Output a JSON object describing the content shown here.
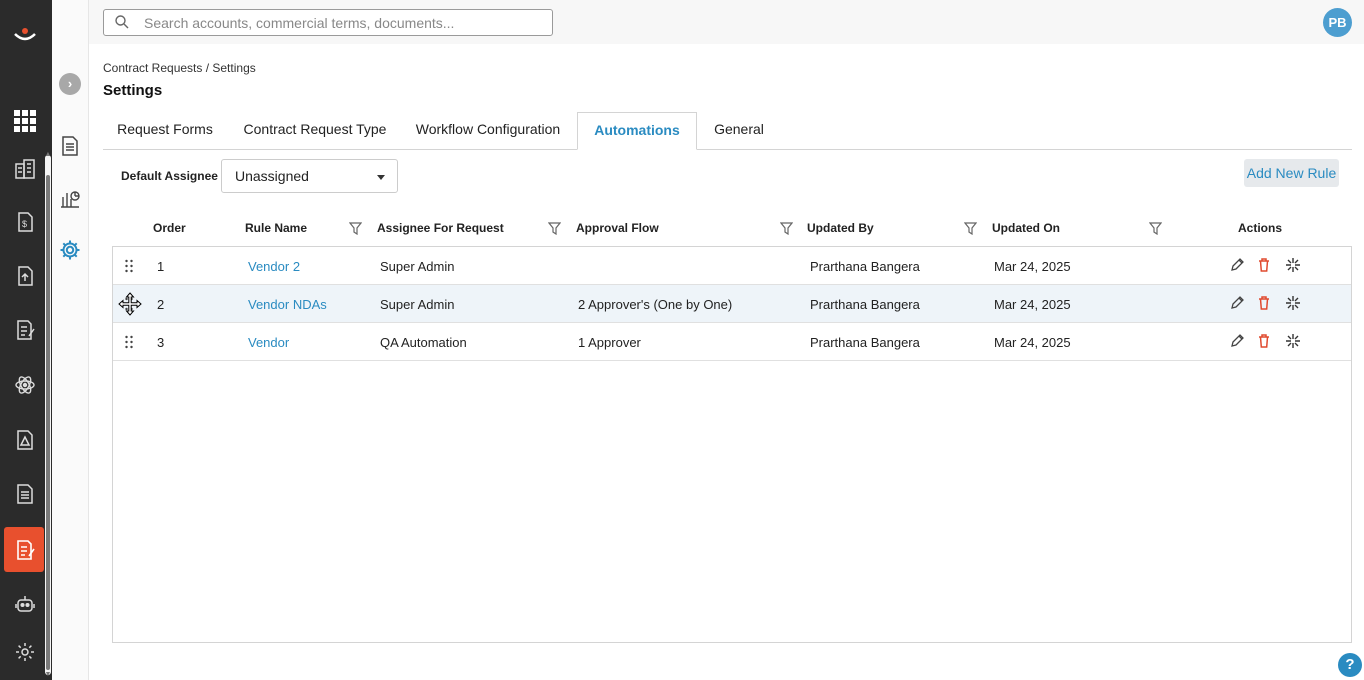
{
  "search": {
    "placeholder": "Search accounts, commercial terms, documents..."
  },
  "user": {
    "initials": "PB"
  },
  "breadcrumb": "Contract Requests / Settings",
  "page_title": "Settings",
  "tabs": [
    {
      "label": "Request Forms",
      "active": false
    },
    {
      "label": "Contract Request Type",
      "active": false
    },
    {
      "label": "Workflow Configuration",
      "active": false
    },
    {
      "label": "Automations",
      "active": true
    },
    {
      "label": "General",
      "active": false
    }
  ],
  "default_assignee": {
    "label": "Default Assignee",
    "value": "Unassigned"
  },
  "add_rule_label": "Add New Rule",
  "table": {
    "columns": [
      "Order",
      "Rule Name",
      "Assignee For Request",
      "Approval Flow",
      "Updated By",
      "Updated On",
      "Actions"
    ],
    "rows": [
      {
        "order": "1",
        "rule_name": "Vendor 2",
        "assignee": "Super Admin",
        "approval_flow": "",
        "updated_by": "Prarthana Bangera",
        "updated_on": "Mar 24, 2025"
      },
      {
        "order": "2",
        "rule_name": "Vendor NDAs",
        "assignee": "Super Admin",
        "approval_flow": "2 Approver's (One by One)",
        "updated_by": "Prarthana Bangera",
        "updated_on": "Mar 24, 2025"
      },
      {
        "order": "3",
        "rule_name": "Vendor",
        "assignee": "QA Automation",
        "approval_flow": "1 Approver",
        "updated_by": "Prarthana Bangera",
        "updated_on": "Mar 24, 2025"
      }
    ]
  },
  "colors": {
    "accent": "#2a8bc1",
    "rail": "#2b2b2b",
    "active_nav": "#e8502e",
    "delete": "#e04a2f"
  },
  "help_label": "?"
}
